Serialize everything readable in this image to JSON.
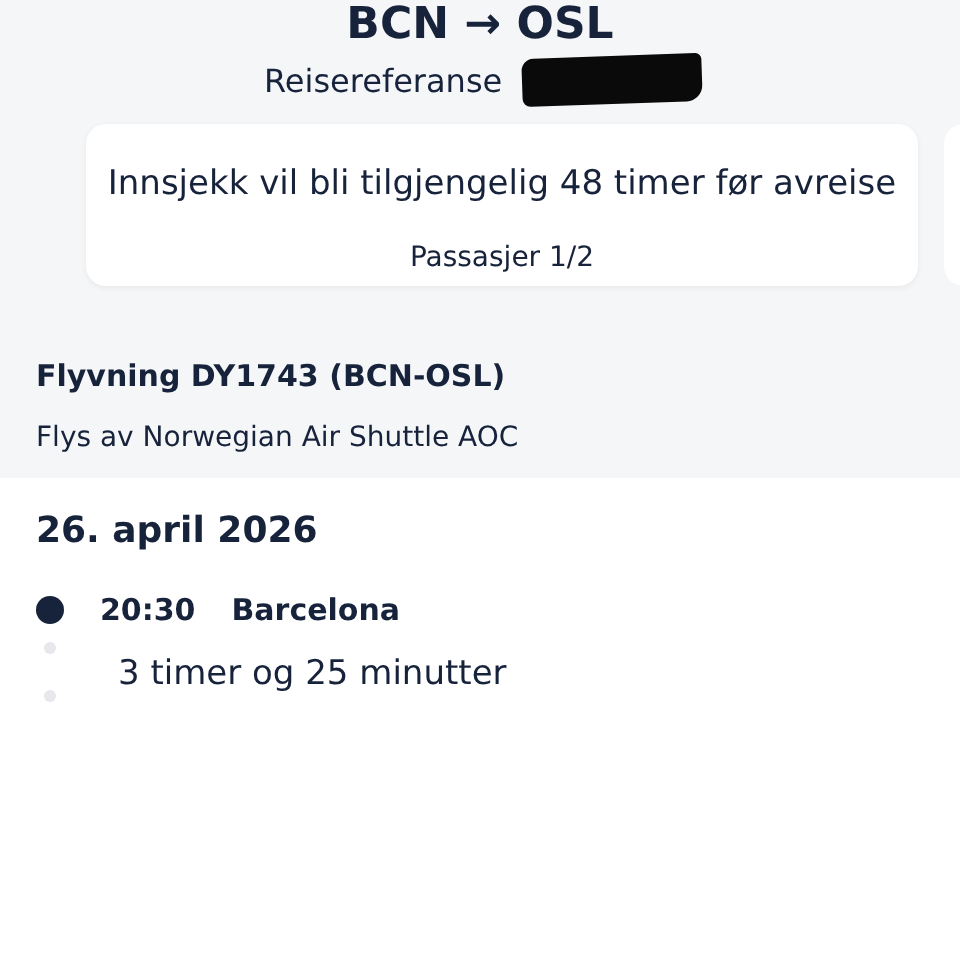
{
  "route": {
    "from": "BCN",
    "arrow": "→",
    "to": "OSL"
  },
  "booking_reference": {
    "label": "Reisereferanse"
  },
  "checkin_card": {
    "message": "Innsjekk vil bli tilgjengelig 48 timer før avreise",
    "passenger": "Passasjer 1/2"
  },
  "flight": {
    "title": "Flyvning DY1743 (BCN-OSL)",
    "operator": "Flys av Norwegian Air Shuttle AOC"
  },
  "itinerary": {
    "date": "26. april 2026",
    "departure": {
      "time": "20:30",
      "place": "Barcelona"
    },
    "duration": "3 timer og 25 minutter"
  }
}
